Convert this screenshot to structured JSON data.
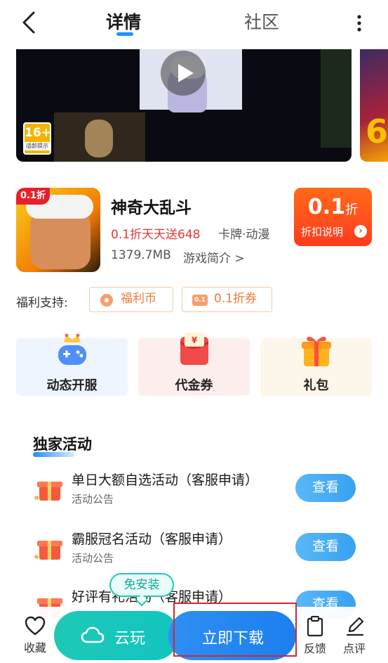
{
  "header": {
    "tabs": [
      {
        "label": "详情",
        "active": true
      },
      {
        "label": "社区",
        "active": false
      }
    ],
    "back_icon": "chevron-left-icon",
    "more_icon": "more-vertical-icon"
  },
  "media": {
    "age_rating": "16+",
    "age_rating_note": "适龄提示",
    "play_icon": "play-icon"
  },
  "game": {
    "name": "神奇大乱斗",
    "icon_tag": "0.1折",
    "promo": "0.1折天天送648",
    "genre": "卡牌·动漫",
    "size": "1379.7MB",
    "intro_link": "游戏简介 >"
  },
  "discount": {
    "value": "0.1",
    "unit": "折",
    "label": "折扣说明"
  },
  "welfare": {
    "label": "福利支持:",
    "chips": [
      {
        "label": "福利币",
        "icon": "coin-icon"
      },
      {
        "label": "0.1折券",
        "icon": "coupon-icon",
        "icon_text": "0.1"
      }
    ]
  },
  "features": [
    {
      "label": "动态开服",
      "icon": "gamepad-crown-icon"
    },
    {
      "label": "代金券",
      "icon": "red-envelope-icon"
    },
    {
      "label": "礼包",
      "icon": "gift-box-icon"
    }
  ],
  "activities": {
    "title": "独家活动",
    "items": [
      {
        "title": "单日大额自选活动（客服申请）",
        "subtitle": "活动公告",
        "button": "查看"
      },
      {
        "title": "霸服冠名活动（客服申请）",
        "subtitle": "活动公告",
        "button": "查看"
      },
      {
        "title": "好评有礼活动（客服申请）",
        "subtitle": "",
        "button": "查看"
      }
    ]
  },
  "bottom_bar": {
    "favorite": "收藏",
    "cloud_play": "云玩",
    "no_install": "免安装",
    "download": "立即下载",
    "feedback": "反馈",
    "review": "点评"
  },
  "colors": {
    "accent_blue": "#1e90ff",
    "promo_red": "#e53935",
    "teal": "#1ec9b6",
    "discount_orange": "#ff4a1e"
  }
}
